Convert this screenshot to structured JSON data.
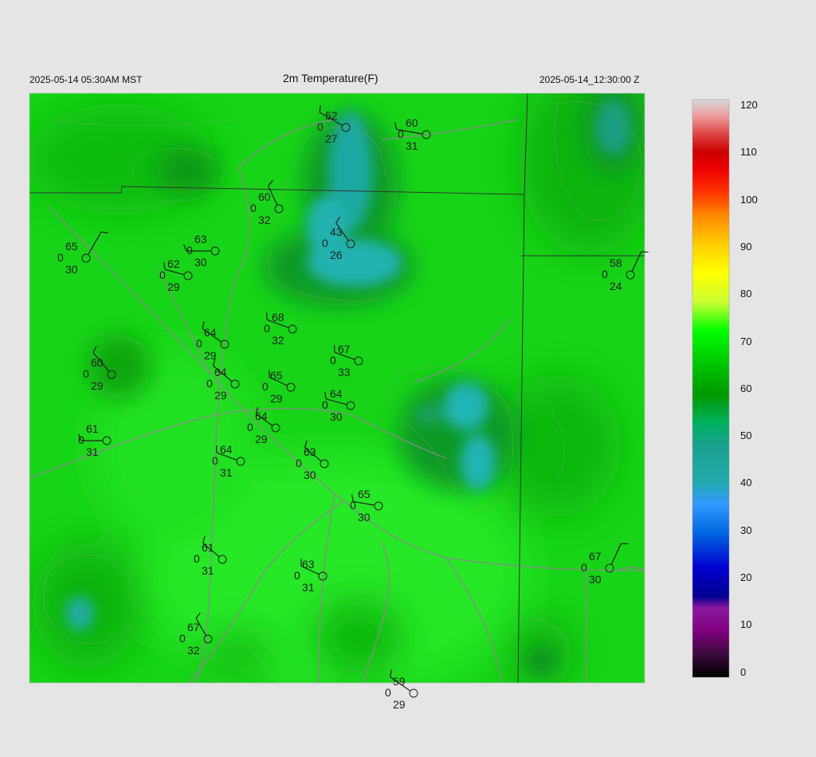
{
  "header": {
    "local_time": "2025-05-14 05:30AM MST",
    "title": "2m Temperature(F)",
    "utc_time": "2025-05-14_12:30:00 Z"
  },
  "colorbar": {
    "ticks": [
      "120",
      "110",
      "100",
      "90",
      "80",
      "70",
      "60",
      "50",
      "40",
      "30",
      "20",
      "10",
      "0"
    ]
  },
  "stations": [
    {
      "temp": "52",
      "gust": "0",
      "dew": "27"
    },
    {
      "temp": "60",
      "gust": "0",
      "dew": "31"
    },
    {
      "temp": "60",
      "gust": "0",
      "dew": "32"
    },
    {
      "temp": "43",
      "gust": "0",
      "dew": "26"
    },
    {
      "temp": "65",
      "gust": "0",
      "dew": "30"
    },
    {
      "temp": "63",
      "gust": "0",
      "dew": "30"
    },
    {
      "temp": "62",
      "gust": "0",
      "dew": "29"
    },
    {
      "temp": "58",
      "gust": "0",
      "dew": "24"
    },
    {
      "temp": "68",
      "gust": "0",
      "dew": "32"
    },
    {
      "temp": "64",
      "gust": "0",
      "dew": "29"
    },
    {
      "temp": "67",
      "gust": "0",
      "dew": "33"
    },
    {
      "temp": "60",
      "gust": "0",
      "dew": "29"
    },
    {
      "temp": "64",
      "gust": "0",
      "dew": "29"
    },
    {
      "temp": "65",
      "gust": "0",
      "dew": "29"
    },
    {
      "temp": "64",
      "gust": "0",
      "dew": "30"
    },
    {
      "temp": "61",
      "gust": "0",
      "dew": "31"
    },
    {
      "temp": "64",
      "gust": "0",
      "dew": "29"
    },
    {
      "temp": "64",
      "gust": "0",
      "dew": "31"
    },
    {
      "temp": "63",
      "gust": "0",
      "dew": "30"
    },
    {
      "temp": "65",
      "gust": "0",
      "dew": "30"
    },
    {
      "temp": "61",
      "gust": "0",
      "dew": "31"
    },
    {
      "temp": "63",
      "gust": "0",
      "dew": "31"
    },
    {
      "temp": "67",
      "gust": "0",
      "dew": "30"
    },
    {
      "temp": "67",
      "gust": "0",
      "dew": "32"
    },
    {
      "temp": "59",
      "gust": "0",
      "dew": "29"
    }
  ]
}
